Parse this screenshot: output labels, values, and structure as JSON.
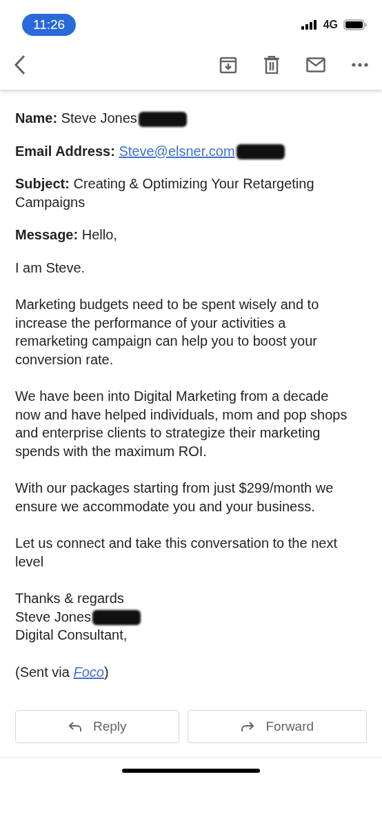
{
  "status_bar": {
    "time": "11:26",
    "network": "4G"
  },
  "fields": [
    {
      "label": "Name:",
      "value": "Steve Jones",
      "kind": "text",
      "redacted": true
    },
    {
      "label": "Email Address:",
      "value": "Steve@elsner.com",
      "kind": "link",
      "redacted": true
    },
    {
      "label": "Subject:",
      "value": "Creating & Optimizing Your Retargeting Campaigns",
      "kind": "text",
      "redacted": false
    },
    {
      "label": "Message:",
      "value": "Hello,",
      "kind": "text",
      "redacted": false
    }
  ],
  "paragraphs": [
    {
      "lines": [
        {
          "text": "I am Steve.",
          "redacted": false
        }
      ]
    },
    {
      "lines": [
        {
          "text": "Marketing budgets need to be spent wisely and to increase the performance of your activities a remarketing campaign can help you to boost your conversion rate.",
          "redacted": false
        }
      ]
    },
    {
      "lines": [
        {
          "text": "We have been into Digital Marketing from a decade now and have helped individuals, mom and pop shops and enterprise clients to strategize their marketing spends with the maximum ROI.",
          "redacted": false
        }
      ]
    },
    {
      "lines": [
        {
          "text": "With our packages starting from just $299/month we ensure we accommodate you and your business.",
          "redacted": false
        }
      ]
    },
    {
      "lines": [
        {
          "text": "Let us connect and take this conversation to the next level",
          "redacted": false
        }
      ]
    },
    {
      "lines": [
        {
          "text": "Thanks & regards",
          "redacted": false
        },
        {
          "text": "Steve Jones",
          "redacted": true
        },
        {
          "text": "Digital Consultant,",
          "redacted": false
        }
      ]
    }
  ],
  "sent_via": {
    "before": "(Sent via",
    "link": "Foco",
    "after": ")"
  },
  "buttons": [
    {
      "label": "Reply",
      "kind": "reply"
    },
    {
      "label": "Forward",
      "kind": "forward"
    }
  ]
}
